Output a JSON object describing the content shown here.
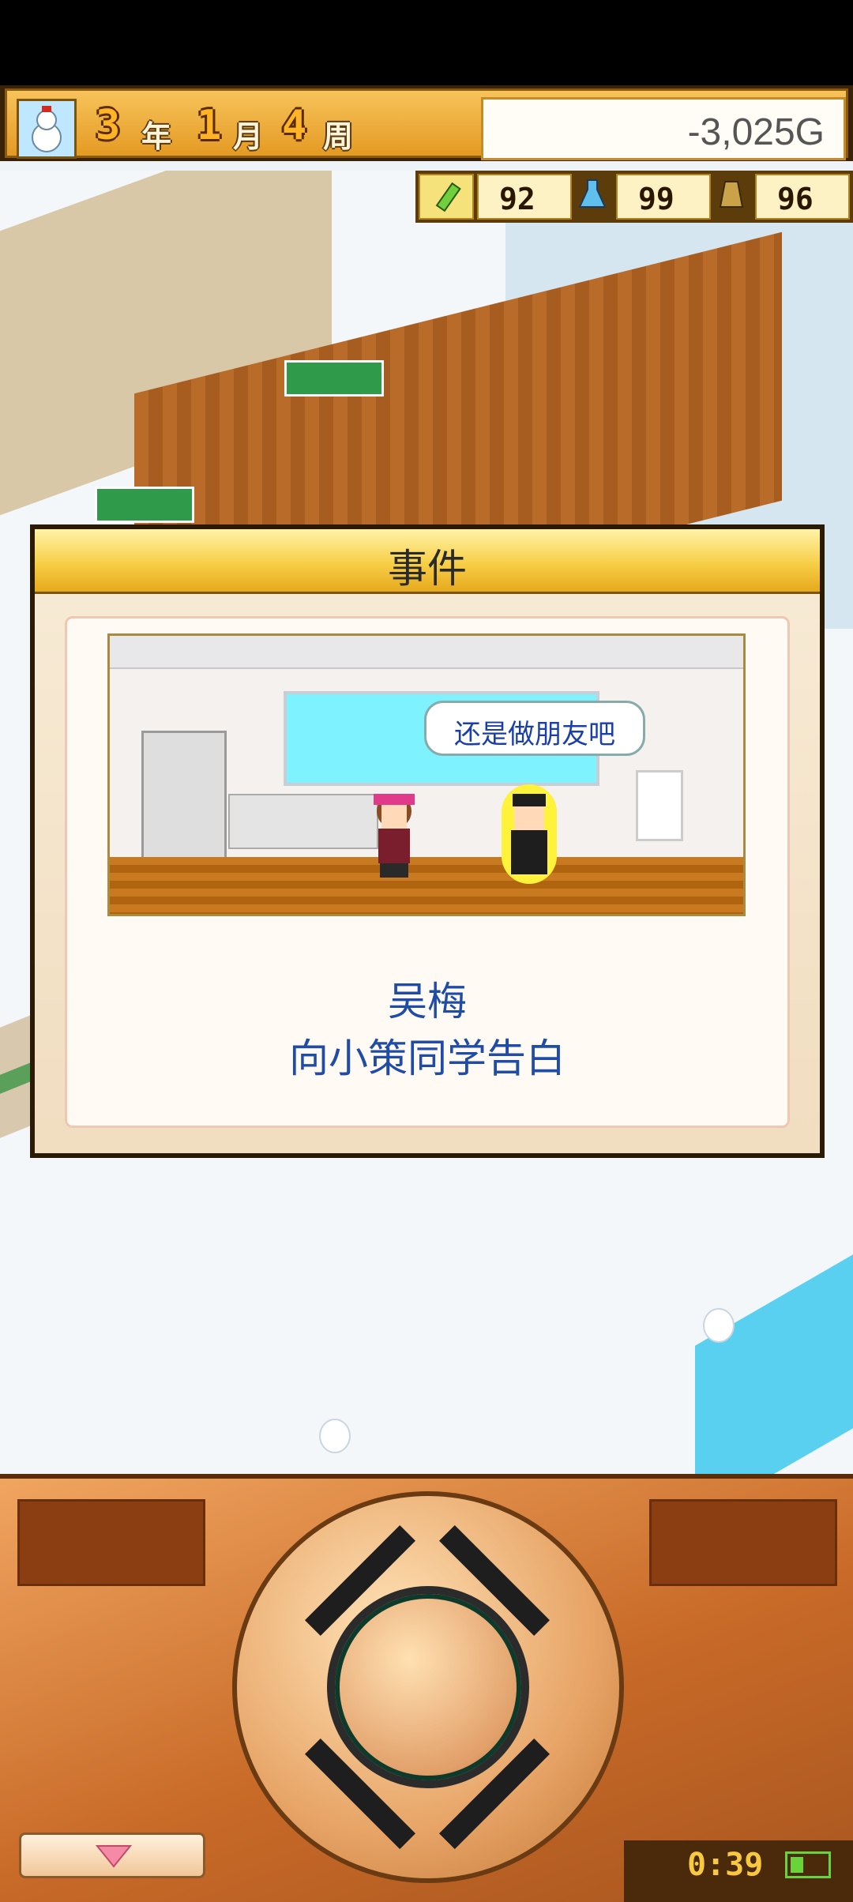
{
  "hud": {
    "year": "3",
    "year_unit": "年",
    "month": "1",
    "month_unit": "月",
    "week": "4",
    "week_unit": "周",
    "money": "-3,025G",
    "stat_study": "92",
    "stat_science": "99",
    "stat_sport": "96"
  },
  "dialog": {
    "title": "事件",
    "speech": "还是做朋友吧",
    "name": "吴梅",
    "description": "向小策同学告白"
  },
  "controls": {
    "clock": "0:39"
  },
  "icons": {
    "avatar": "snowman-icon",
    "study": "pencil-icon",
    "science": "flask-icon",
    "sport": "weight-icon",
    "menu": "triangle-down-icon",
    "battery": "battery-icon"
  },
  "colors": {
    "hud_gold": "#f2b03a",
    "dialog_text": "#1f4ca6",
    "panel_wood": "#c86a28"
  }
}
